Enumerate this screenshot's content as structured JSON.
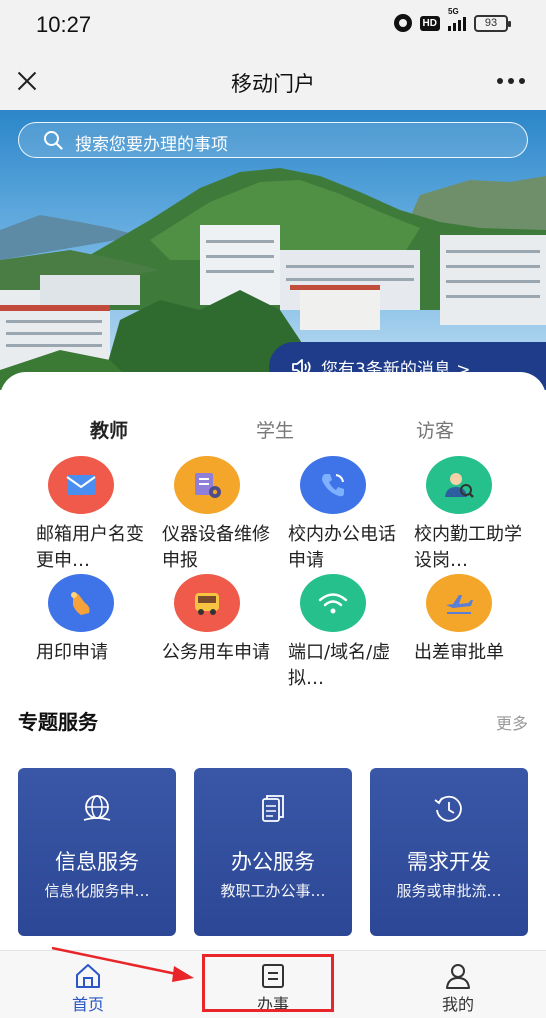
{
  "status_bar": {
    "time": "10:27",
    "battery": "93",
    "network": "5G",
    "hd": "HD"
  },
  "header": {
    "title": "移动门户"
  },
  "search": {
    "placeholder": "搜索您要办理的事项"
  },
  "notice": {
    "text": "您有3条新的消息 >"
  },
  "tabs": [
    {
      "label": "教师",
      "active": true
    },
    {
      "label": "学生",
      "active": false
    },
    {
      "label": "访客",
      "active": false
    }
  ],
  "apps": [
    {
      "label": "邮箱用户名变更申…",
      "icon": "mail-icon",
      "color": "#ef5a4a"
    },
    {
      "label": "仪器设备维修申报",
      "icon": "equipment-icon",
      "color": "#f4a62a"
    },
    {
      "label": "校内办公电话申请",
      "icon": "phone-icon",
      "color": "#3f74e8"
    },
    {
      "label": "校内勤工助学设岗…",
      "icon": "person-search-icon",
      "color": "#25c08c"
    },
    {
      "label": "用印申请",
      "icon": "stamp-hand-icon",
      "color": "#3f74e8"
    },
    {
      "label": "公务用车申请",
      "icon": "bus-icon",
      "color": "#ef5a4a"
    },
    {
      "label": "端口/域名/虚拟…",
      "icon": "wifi-icon",
      "color": "#25c08c"
    },
    {
      "label": "出差审批单",
      "icon": "plane-icon",
      "color": "#f4a62a"
    }
  ],
  "services_section": {
    "title": "专题服务",
    "more": "更多"
  },
  "services": [
    {
      "title": "信息服务",
      "subtitle": "信息化服务申…",
      "icon": "globe-icon"
    },
    {
      "title": "办公服务",
      "subtitle": "教职工办公事…",
      "icon": "document-icon"
    },
    {
      "title": "需求开发",
      "subtitle": "服务或审批流…",
      "icon": "history-icon"
    }
  ],
  "bottom_nav": [
    {
      "label": "首页",
      "icon": "home-icon",
      "active": true
    },
    {
      "label": "办事",
      "icon": "task-list-icon",
      "active": false
    },
    {
      "label": "我的",
      "icon": "user-icon",
      "active": false
    }
  ],
  "colors": {
    "accent": "#2a56c6",
    "card": "#2f4c9b",
    "highlight": "#e8262a"
  }
}
